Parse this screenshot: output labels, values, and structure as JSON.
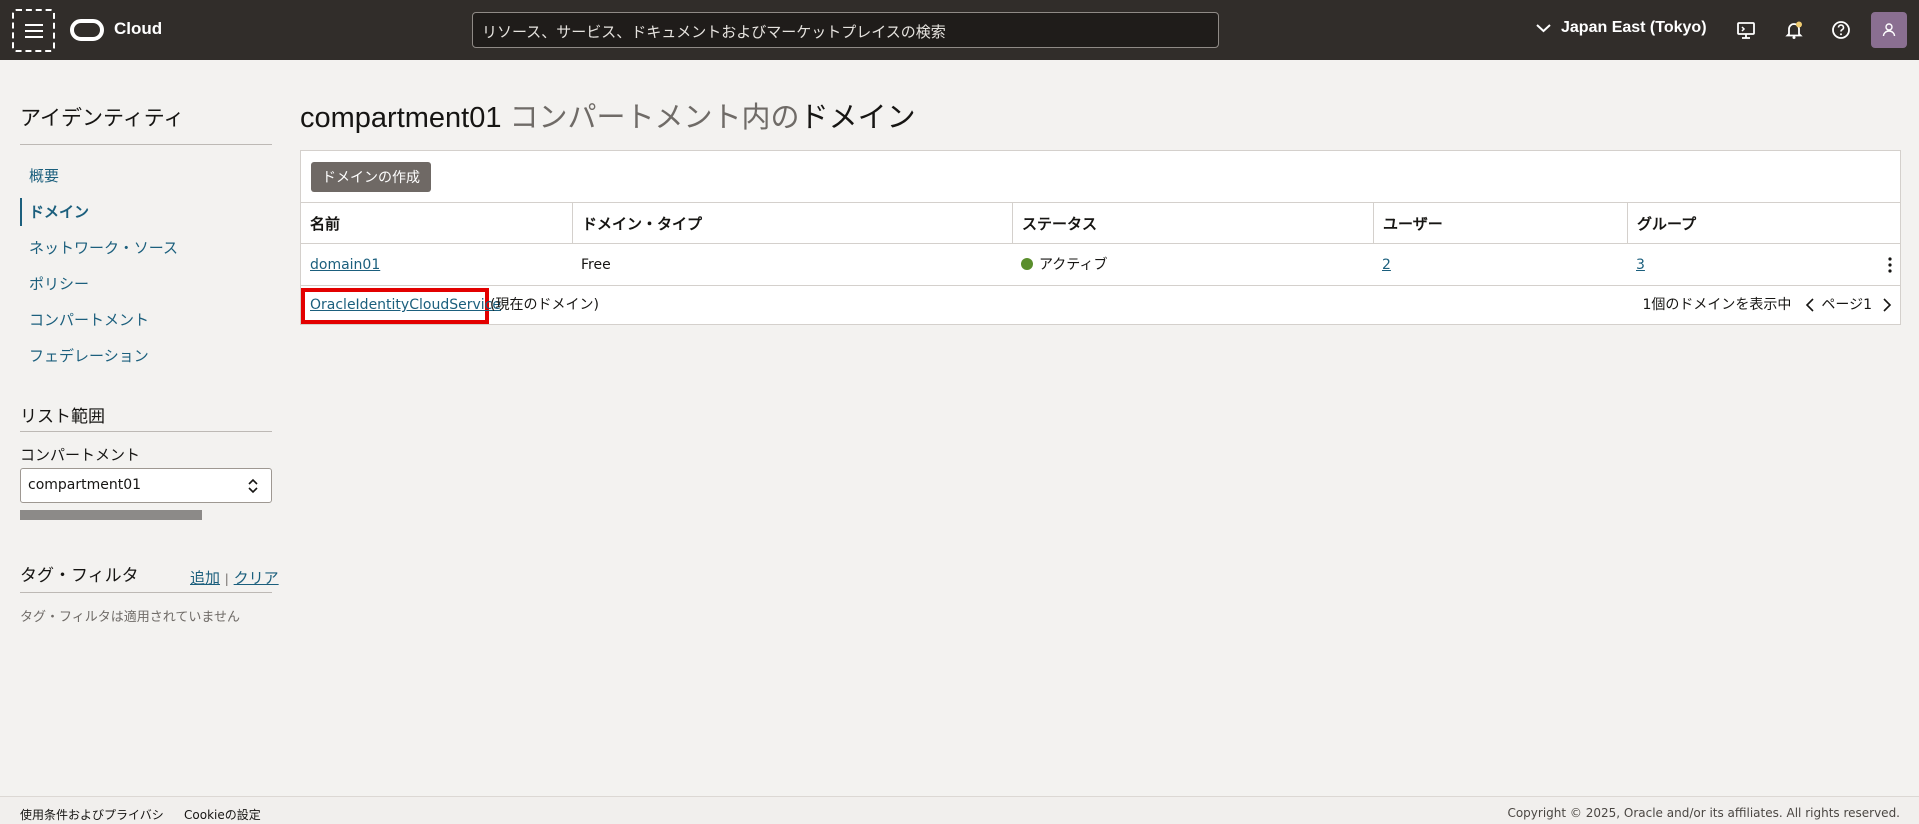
{
  "header": {
    "brand": "Cloud",
    "search_placeholder": "リソース、サービス、ドキュメントおよびマーケットプレイスの検索",
    "region": "Japan East (Tokyo)"
  },
  "sidebar": {
    "title": "アイデンティティ",
    "items": [
      {
        "label": "概要"
      },
      {
        "label": "ドメイン"
      },
      {
        "label": "ネットワーク・ソース"
      },
      {
        "label": "ポリシー"
      },
      {
        "label": "コンパートメント"
      },
      {
        "label": "フェデレーション"
      }
    ],
    "list_scope_title": "リスト範囲",
    "compartment_label": "コンパートメント",
    "compartment_value": "compartment01",
    "tag_filter_title": "タグ・フィルタ",
    "tag_add": "追加",
    "tag_separator": "|",
    "tag_clear": "クリア",
    "tag_empty": "タグ・フィルタは適用されていません"
  },
  "main": {
    "title_compartment": "compartment01",
    "title_middle": " コンパートメント内の",
    "title_end": "ドメイン",
    "create_button": "ドメインの作成",
    "columns": [
      "名前",
      "ドメイン・タイプ",
      "ステータス",
      "ユーザー",
      "グループ"
    ],
    "rows": [
      {
        "name": "domain01",
        "type": "Free",
        "status": "アクティブ",
        "users": "2",
        "groups": "3"
      }
    ],
    "current_domain_link": "OracleIdentityCloudService",
    "current_domain_suffix": "(現在のドメイン)",
    "pager_text": "1個のドメインを表示中",
    "page_label": "ページ1",
    "status_color": "#5a8e2c"
  },
  "footer": {
    "terms": "使用条件およびプライバシ",
    "cookies": "Cookieの設定",
    "copyright": "Copyright © 2025, Oracle and/or its affiliates. All rights reserved."
  }
}
